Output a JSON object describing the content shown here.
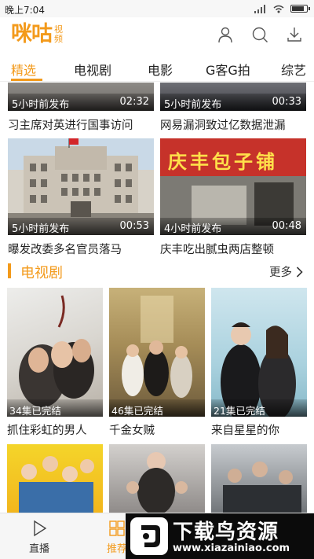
{
  "status_bar": {
    "time": "晚上7:04"
  },
  "header": {
    "brand": "咪咕",
    "brand_sub": "视频",
    "icons": [
      "user-icon",
      "search-icon",
      "download-icon"
    ]
  },
  "tabs": [
    {
      "label": "精选",
      "active": true
    },
    {
      "label": "电视剧",
      "active": false
    },
    {
      "label": "电影",
      "active": false
    },
    {
      "label": "G客G拍",
      "active": false
    },
    {
      "label": "综艺",
      "active": false
    }
  ],
  "news": [
    {
      "ago": "5小时前发布",
      "duration": "02:32",
      "title": "习主席对英进行国事访问"
    },
    {
      "ago": "5小时前发布",
      "duration": "00:33",
      "title": "网易漏洞致过亿数据泄漏"
    },
    {
      "ago": "5小时前发布",
      "duration": "00:53",
      "title": "曝发改委多名官员落马",
      "sign_text": ""
    },
    {
      "ago": "4小时前发布",
      "duration": "00:48",
      "title": "庆丰吃出腻虫两店整顿",
      "sign_text": "庆丰包子铺"
    }
  ],
  "tv_section": {
    "title": "电视剧",
    "more": "更多",
    "items": [
      {
        "badge": "34集已完结",
        "title": "抓住彩虹的男人"
      },
      {
        "badge": "46集已完结",
        "title": "千金女贼"
      },
      {
        "badge": "21集已完结",
        "title": "来自星星的你"
      }
    ]
  },
  "bottom_nav": [
    {
      "label": "直播",
      "icon": "play-icon",
      "active": false
    },
    {
      "label": "推荐",
      "icon": "grid-icon",
      "active": true
    }
  ],
  "watermark": {
    "name": "下载鸟资源",
    "url": "www.xiazainiao.com"
  },
  "colors": {
    "accent": "#f39a1b"
  }
}
